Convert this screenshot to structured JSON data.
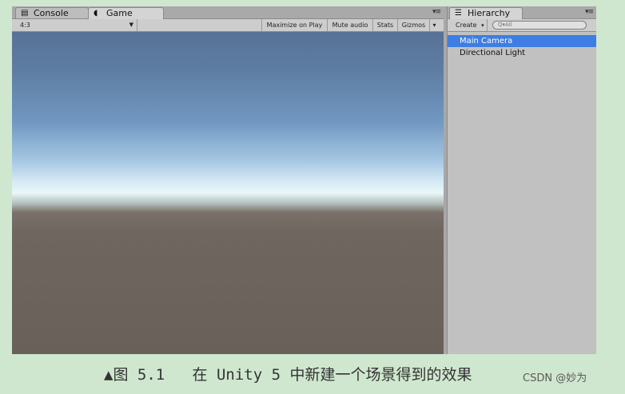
{
  "game_panel": {
    "tabs": [
      {
        "label": "Console",
        "icon": "console-icon"
      },
      {
        "label": "Game",
        "icon": "game-pacman-icon"
      }
    ],
    "panel_menu": "▾≡",
    "aspect": "4:3",
    "toolbar": {
      "maximize": "Maximize on Play",
      "mute": "Mute audio",
      "stats": "Stats",
      "gizmos": "Gizmos"
    }
  },
  "hierarchy": {
    "tab_label": "Hierarchy",
    "panel_menu": "▾≡",
    "create": "Create",
    "search_placeholder": "Q▾All",
    "items": [
      {
        "label": "Main Camera",
        "selected": true
      },
      {
        "label": "Directional Light",
        "selected": false
      }
    ]
  },
  "caption": "▲图 5.1   在 Unity 5 中新建一个场景得到的效果",
  "watermark": "CSDN @妙为"
}
